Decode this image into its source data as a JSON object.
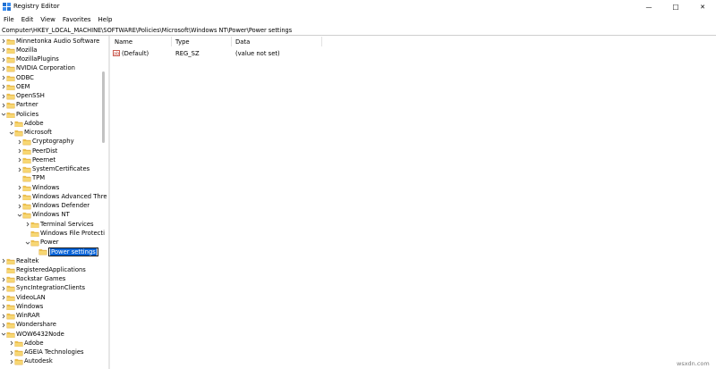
{
  "window": {
    "title": "Registry Editor",
    "controls": {
      "minimize": "—",
      "maximize": "☐",
      "close": "✕"
    }
  },
  "menu": [
    "File",
    "Edit",
    "View",
    "Favorites",
    "Help"
  ],
  "address": "Computer\\HKEY_LOCAL_MACHINE\\SOFTWARE\\Policies\\Microsoft\\Windows NT\\Power\\Power settings",
  "tree": [
    {
      "label": "Minnetonka Audio Software",
      "depth": 0,
      "expander": true
    },
    {
      "label": "Mozilla",
      "depth": 0,
      "expander": true
    },
    {
      "label": "MozillaPlugins",
      "depth": 0,
      "expander": true
    },
    {
      "label": "NVIDIA Corporation",
      "depth": 0,
      "expander": true
    },
    {
      "label": "ODBC",
      "depth": 0,
      "expander": true
    },
    {
      "label": "OEM",
      "depth": 0,
      "expander": true
    },
    {
      "label": "OpenSSH",
      "depth": 0,
      "expander": true
    },
    {
      "label": "Partner",
      "depth": 0,
      "expander": true
    },
    {
      "label": "Policies",
      "depth": 0,
      "expander": true,
      "expanded": true
    },
    {
      "label": "Adobe",
      "depth": 1,
      "expander": true
    },
    {
      "label": "Microsoft",
      "depth": 1,
      "expander": true,
      "expanded": true
    },
    {
      "label": "Cryptography",
      "depth": 2,
      "expander": true
    },
    {
      "label": "PeerDist",
      "depth": 2,
      "expander": true
    },
    {
      "label": "Peernet",
      "depth": 2,
      "expander": true
    },
    {
      "label": "SystemCertificates",
      "depth": 2,
      "expander": true
    },
    {
      "label": "TPM",
      "depth": 2,
      "expander": false
    },
    {
      "label": "Windows",
      "depth": 2,
      "expander": true
    },
    {
      "label": "Windows Advanced Thre",
      "depth": 2,
      "expander": true
    },
    {
      "label": "Windows Defender",
      "depth": 2,
      "expander": true
    },
    {
      "label": "Windows NT",
      "depth": 2,
      "expander": true,
      "expanded": true
    },
    {
      "label": "Terminal Services",
      "depth": 3,
      "expander": true
    },
    {
      "label": "Windows File Protecti",
      "depth": 3,
      "expander": false
    },
    {
      "label": "Power",
      "depth": 3,
      "expander": true,
      "expanded": true
    },
    {
      "label": "Power settings",
      "depth": 4,
      "expander": false,
      "editing": true
    },
    {
      "label": "Realtek",
      "depth": 0,
      "expander": true
    },
    {
      "label": "RegisteredApplications",
      "depth": 0,
      "expander": false
    },
    {
      "label": "Rockstar Games",
      "depth": 0,
      "expander": true
    },
    {
      "label": "SyncIntegrationClients",
      "depth": 0,
      "expander": true
    },
    {
      "label": "VideoLAN",
      "depth": 0,
      "expander": true
    },
    {
      "label": "Windows",
      "depth": 0,
      "expander": true
    },
    {
      "label": "WinRAR",
      "depth": 0,
      "expander": true
    },
    {
      "label": "Wondershare",
      "depth": 0,
      "expander": true
    },
    {
      "label": "WOW6432Node",
      "depth": 0,
      "expander": true,
      "expanded": true
    },
    {
      "label": "Adobe",
      "depth": 1,
      "expander": true
    },
    {
      "label": "AGEIA Technologies",
      "depth": 1,
      "expander": true
    },
    {
      "label": "Autodesk",
      "depth": 1,
      "expander": true
    }
  ],
  "list": {
    "columns": {
      "name": "Name",
      "type": "Type",
      "data": "Data"
    },
    "rows": [
      {
        "name": "(Default)",
        "type": "REG_SZ",
        "data": "(value not set)"
      }
    ]
  },
  "watermark": "wsxdn.com",
  "colors": {
    "folder": "#f2c94c",
    "folder_dark": "#e0a93a",
    "selection": "#0a64d8",
    "value_icon": "#c0392b"
  },
  "icons": {
    "app": "registry-editor-icon",
    "folder": "folder-icon",
    "value": "string-value-icon"
  }
}
